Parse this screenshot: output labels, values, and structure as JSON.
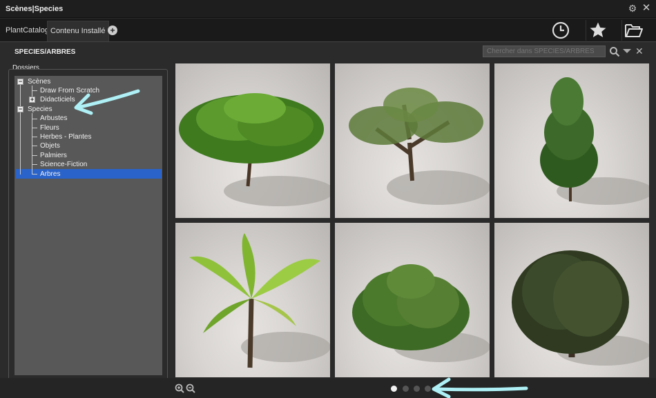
{
  "window": {
    "title": "Scènes|Species"
  },
  "tabs": [
    {
      "label": "PlantCatalog"
    },
    {
      "label": "Contenu Installé"
    }
  ],
  "toolbar": {
    "history_icon": "clock-icon",
    "favorites_icon": "star-icon",
    "open_icon": "folder-open-icon"
  },
  "path": "SPECIES/ARBRES",
  "search": {
    "placeholder": "Chercher dans SPECIES/ARBRES"
  },
  "folders": {
    "label": "Dossiers",
    "tree": [
      {
        "label": "Scènes",
        "expander": "−"
      },
      {
        "label": "Draw From Scratch"
      },
      {
        "label": "Didacticiels",
        "expander": "+"
      },
      {
        "label": "Species",
        "expander": "−"
      },
      {
        "label": "Arbustes"
      },
      {
        "label": "Fleurs"
      },
      {
        "label": "Herbes - Plantes"
      },
      {
        "label": "Objets"
      },
      {
        "label": "Palmiers"
      },
      {
        "label": "Science-Fiction"
      },
      {
        "label": "Arbres",
        "selected": true
      }
    ]
  },
  "thumbnails": [
    {
      "kind": "broad-tree",
      "canopy": "#4f8a25"
    },
    {
      "kind": "gnarled-tree",
      "canopy": "#5d7a3a"
    },
    {
      "kind": "conifer",
      "canopy": "#3d6a2a"
    },
    {
      "kind": "banana-palm",
      "canopy": "#8fc23a"
    },
    {
      "kind": "shrub",
      "canopy": "#4c7a2c"
    },
    {
      "kind": "willow",
      "canopy": "#3b4a2a"
    }
  ],
  "pagination": {
    "pages": 4,
    "current": 1
  },
  "annotations": {
    "arrow_color": "#aef0f5"
  }
}
